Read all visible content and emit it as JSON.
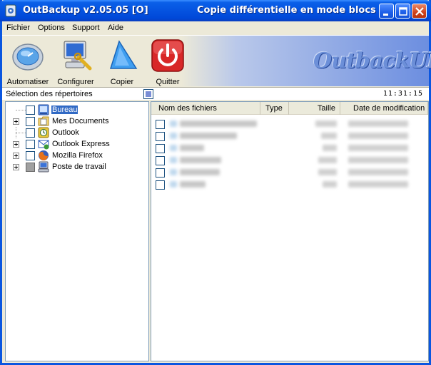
{
  "window": {
    "app_title": "OutBackup  v2.05.05 [O]",
    "subtitle": "Copie différentielle en mode blocs"
  },
  "menu": [
    "Fichier",
    "Options",
    "Support",
    "Aide"
  ],
  "toolbar": {
    "automate": "Automatiser",
    "configure": "Configurer",
    "copy": "Copier",
    "quit": "Quitter",
    "brand": "OutbackUP"
  },
  "selection": {
    "label": "Sélection des répertoires",
    "clock": "11:31:15"
  },
  "tree": [
    {
      "label": "Bureau",
      "icon": "desktop-icon",
      "expandable": false,
      "selected": true,
      "state": "unchecked"
    },
    {
      "label": "Mes Documents",
      "icon": "documents-folder-icon",
      "expandable": true,
      "selected": false,
      "state": "unchecked"
    },
    {
      "label": "Outlook",
      "icon": "outlook-icon",
      "expandable": false,
      "selected": false,
      "state": "unchecked"
    },
    {
      "label": "Outlook Express",
      "icon": "outlook-express-icon",
      "expandable": true,
      "selected": false,
      "state": "unchecked"
    },
    {
      "label": "Mozilla Firefox",
      "icon": "firefox-icon",
      "expandable": true,
      "selected": false,
      "state": "unchecked"
    },
    {
      "label": "Poste de travail",
      "icon": "computer-icon",
      "expandable": true,
      "selected": false,
      "state": "partial"
    }
  ],
  "file_list": {
    "columns": [
      "Nom des fichiers",
      "Type",
      "Taille",
      "Date de modification"
    ],
    "row_count_visible": 6
  }
}
